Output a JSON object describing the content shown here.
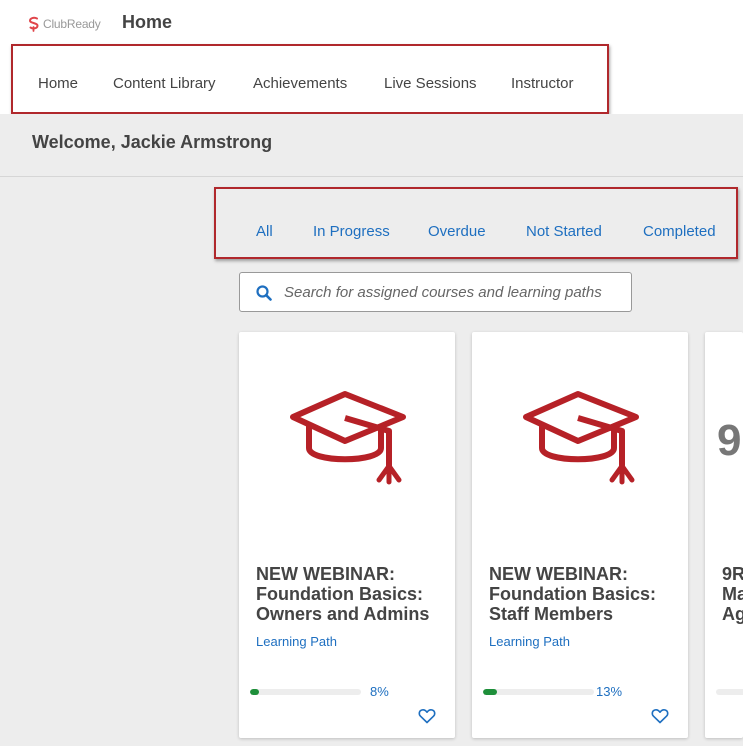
{
  "header": {
    "logo_text": "ClubReady",
    "page_title": "Home"
  },
  "nav": {
    "items": [
      {
        "label": "Home"
      },
      {
        "label": "Content Library"
      },
      {
        "label": "Achievements"
      },
      {
        "label": "Live Sessions"
      },
      {
        "label": "Instructor"
      }
    ]
  },
  "welcome": "Welcome, Jackie Armstrong",
  "filters": {
    "items": [
      {
        "label": "All"
      },
      {
        "label": "In Progress"
      },
      {
        "label": "Overdue"
      },
      {
        "label": "Not Started"
      },
      {
        "label": "Completed"
      }
    ]
  },
  "search": {
    "placeholder": "Search for assigned courses and learning paths",
    "value": ""
  },
  "cards": [
    {
      "icon": "graduation-cap-icon",
      "title": "NEW WEBINAR: Foundation Basics: Owners and Admins",
      "type": "Learning Path",
      "progress": 8,
      "progress_label": "8%"
    },
    {
      "icon": "graduation-cap-icon",
      "title": "NEW WEBINAR: Foundation Basics: Staff Members",
      "type": "Learning Path",
      "progress": 13,
      "progress_label": "13%"
    },
    {
      "thumb_text": "9",
      "title_lines": [
        "9R",
        "Ma",
        "Ag"
      ]
    }
  ],
  "colors": {
    "accent_red": "#b0282c",
    "link_blue": "#1e6fc0",
    "progress_green": "#1e8f3a"
  }
}
